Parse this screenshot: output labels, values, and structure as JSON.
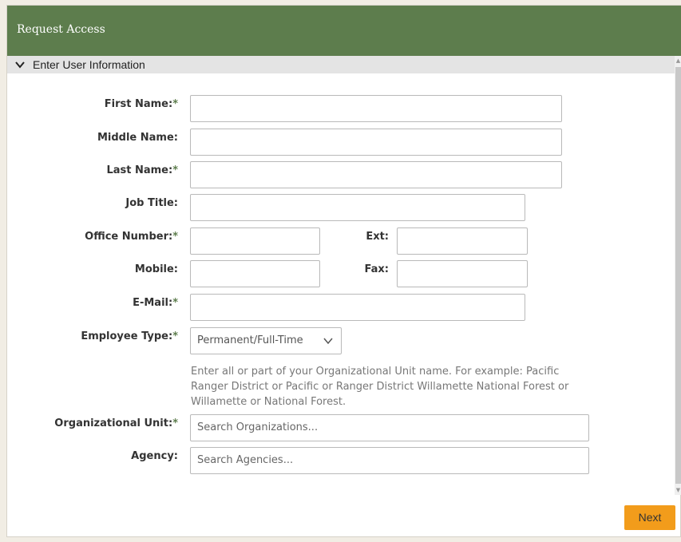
{
  "dialog": {
    "title": "Request Access"
  },
  "section": {
    "title": "Enter User Information"
  },
  "form": {
    "first_name": {
      "label": "First Name:",
      "required": "*",
      "value": ""
    },
    "middle_name": {
      "label": "Middle Name:",
      "value": ""
    },
    "last_name": {
      "label": "Last Name:",
      "required": "*",
      "value": ""
    },
    "job_title": {
      "label": "Job Title:",
      "value": ""
    },
    "office_number": {
      "label": "Office Number:",
      "required": "*",
      "value": ""
    },
    "ext": {
      "label": "Ext:",
      "value": ""
    },
    "mobile": {
      "label": "Mobile:",
      "value": ""
    },
    "fax": {
      "label": "Fax:",
      "value": ""
    },
    "email": {
      "label": "E-Mail:",
      "required": "*",
      "value": ""
    },
    "employee_type": {
      "label": "Employee Type:",
      "required": "*",
      "value": "Permanent/Full-Time"
    },
    "org_unit_hint": "Enter all or part of your Organizational Unit name. For example: Pacific Ranger District or Pacific or Ranger District Willamette National Forest or Willamette or National Forest.",
    "org_unit": {
      "label": "Organizational Unit:",
      "required": "*",
      "placeholder": "Search Organizations..."
    },
    "agency": {
      "label": "Agency:",
      "placeholder": "Search Agencies..."
    }
  },
  "actions": {
    "next_label": "Next"
  },
  "colors": {
    "title_bar": "#5d7d4d",
    "required_star": "#5d7d4d",
    "next_button": "#f29c1b"
  }
}
